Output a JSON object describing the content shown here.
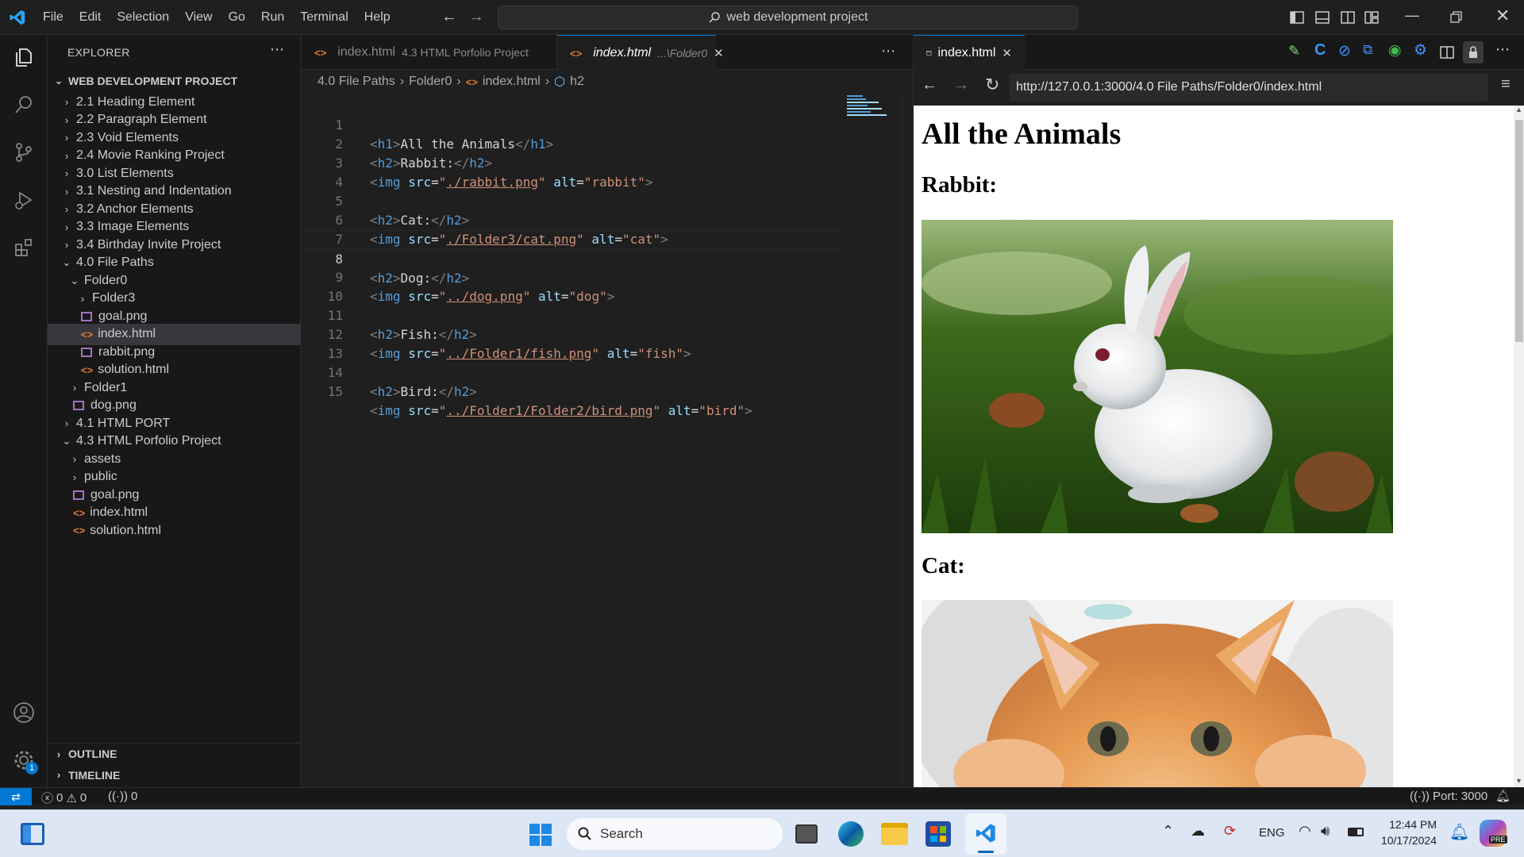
{
  "titlebar": {
    "menu": [
      "File",
      "Edit",
      "Selection",
      "View",
      "Go",
      "Run",
      "Terminal",
      "Help"
    ],
    "search_text": "web development project"
  },
  "sidebar": {
    "title": "EXPLORER",
    "project": "WEB DEVELOPMENT PROJECT",
    "items": [
      {
        "label": "2.1 Heading Element",
        "type": "folder"
      },
      {
        "label": "2.2 Paragraph Element",
        "type": "folder"
      },
      {
        "label": "2.3 Void Elements",
        "type": "folder"
      },
      {
        "label": "2.4 Movie Ranking Project",
        "type": "folder"
      },
      {
        "label": "3.0 List Elements",
        "type": "folder"
      },
      {
        "label": "3.1 Nesting and Indentation",
        "type": "folder"
      },
      {
        "label": "3.2 Anchor Elements",
        "type": "folder"
      },
      {
        "label": "3.3 Image Elements",
        "type": "folder"
      },
      {
        "label": "3.4 Birthday Invite Project",
        "type": "folder"
      },
      {
        "label": "4.0 File Paths",
        "type": "folder-open"
      },
      {
        "label": "Folder0",
        "type": "folder-open"
      },
      {
        "label": "Folder3",
        "type": "folder"
      },
      {
        "label": "goal.png",
        "type": "png"
      },
      {
        "label": "index.html",
        "type": "html"
      },
      {
        "label": "rabbit.png",
        "type": "png"
      },
      {
        "label": "solution.html",
        "type": "html"
      },
      {
        "label": "Folder1",
        "type": "folder"
      },
      {
        "label": "dog.png",
        "type": "png"
      },
      {
        "label": "4.1 HTML PORT",
        "type": "folder"
      },
      {
        "label": "4.3 HTML Porfolio Project",
        "type": "folder-open"
      },
      {
        "label": "assets",
        "type": "folder"
      },
      {
        "label": "public",
        "type": "folder"
      },
      {
        "label": "goal.png",
        "type": "png"
      },
      {
        "label": "index.html",
        "type": "html"
      },
      {
        "label": "solution.html",
        "type": "html"
      }
    ],
    "outline": "OUTLINE",
    "timeline": "TIMELINE"
  },
  "editor": {
    "tab1_name": "index.html",
    "tab1_desc": "4.3 HTML Porfolio Project",
    "tab2_name": "index.html",
    "tab2_desc": "...\\Folder0",
    "breadcrumb": [
      "4.0 File Paths",
      "Folder0",
      "index.html",
      "h2"
    ],
    "line_numbers": [
      "1",
      "2",
      "3",
      "4",
      "5",
      "6",
      "7",
      "8",
      "9",
      "10",
      "11",
      "12",
      "13",
      "14",
      "15"
    ],
    "code": {
      "h1_text": "All the Animals",
      "rabbit_h2": "Rabbit:",
      "rabbit_src": "./rabbit.png",
      "rabbit_alt": "rabbit",
      "cat_h2": "Cat:",
      "cat_src": "./Folder3/cat.png",
      "cat_alt": "cat",
      "dog_h2": "Dog:",
      "dog_src": "../dog.png",
      "dog_alt": "dog",
      "fish_h2": "Fish:",
      "fish_src": "../Folder1/fish.png",
      "fish_alt": "fish",
      "bird_h2": "Bird:",
      "bird_src": "../Folder1/Folder2/bird.png",
      "bird_alt": "bird"
    }
  },
  "browser": {
    "tab_title": "index.html",
    "url": "http://127.0.0.1:3000/4.0 File Paths/Folder0/index.html",
    "page_title": "All the Animals",
    "rabbit_heading": "Rabbit:",
    "cat_heading": "Cat:"
  },
  "status": {
    "errors": "0",
    "warnings": "0",
    "ports": "0",
    "port_label": "Port: 3000",
    "badge": "1"
  },
  "taskbar": {
    "search": "Search",
    "lang": "ENG",
    "time": "12:44 PM",
    "date": "10/17/2024",
    "copilot_badge": "PRE"
  },
  "colors": {
    "accent": "#0078d4",
    "html_icon": "#e37933",
    "png_icon": "#a074c4"
  }
}
